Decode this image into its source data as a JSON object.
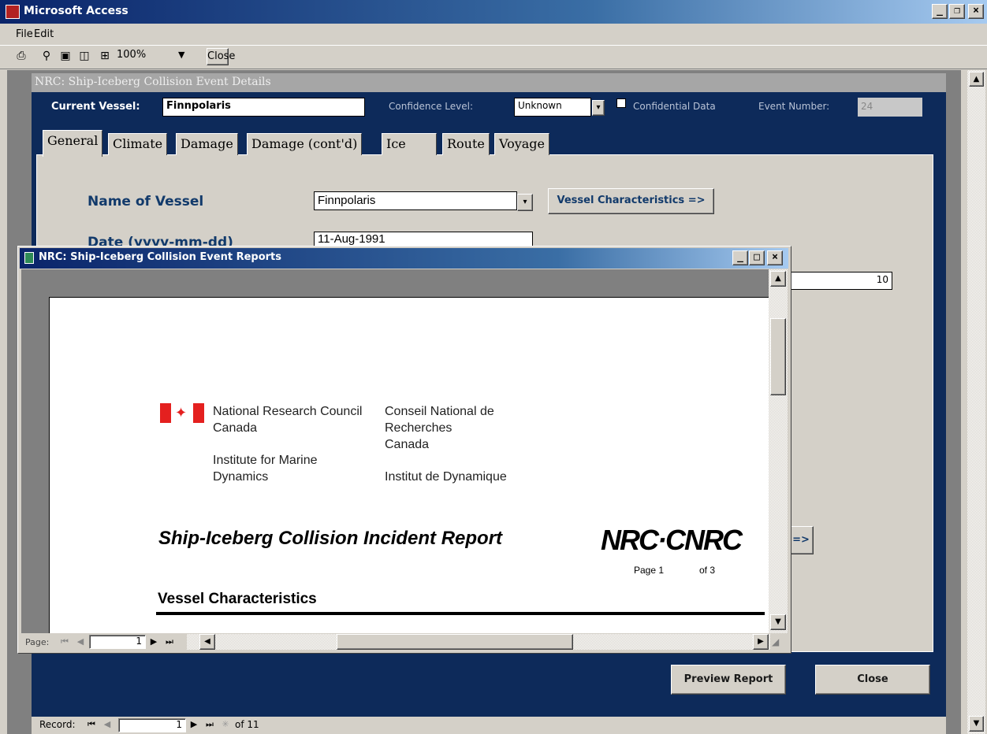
{
  "app": {
    "title": "Microsoft Access",
    "controls": [
      "_",
      "❐",
      "×"
    ]
  },
  "menu": {
    "file": "File",
    "edit": "Edit"
  },
  "toolbar": {
    "zoom": "100%",
    "close": "Close"
  },
  "form": {
    "title": "NRC: Ship-Iceberg Collision Event Details",
    "current_vessel_label": "Current Vessel:",
    "current_vessel_value": "Finnpolaris",
    "confidence_label": "Confidence Level:",
    "confidence_value": "Unknown",
    "confidential_label": "Confidential Data",
    "event_number_label": "Event Number:",
    "event_number_value": "24",
    "tabs": [
      "General",
      "Climate",
      "Damage",
      "Damage (cont'd)",
      "Ice",
      "Route",
      "Voyage"
    ],
    "name_of_vessel_label": "Name of Vessel",
    "name_of_vessel_value": "Finnpolaris",
    "vessel_characteristics_button": "Vessel Characteristics =>",
    "date_label": "Date (yyyy-mm-dd)",
    "date_value": "11-Aug-1991",
    "partial_field_value": "10",
    "partial_button": "=>",
    "preview_button": "Preview Report",
    "close_button": "Close",
    "record_label": "Record:",
    "record_current": "1",
    "record_total": "of 11"
  },
  "report": {
    "window_title": "NRC: Ship-Iceberg Collision Event Reports",
    "org_en_1": "National Research Council",
    "org_en_2": "Canada",
    "org_fr_1": "Conseil National de",
    "org_fr_2": "Recherches",
    "org_fr_3": "Canada",
    "inst_en_1": "Institute for Marine",
    "inst_en_2": "Dynamics",
    "inst_fr": "Institut de Dynamique",
    "heading": "Ship-Iceberg Collision Incident Report",
    "logo": "NRC·CNRC",
    "page_label": "Page 1",
    "page_of": "of 3",
    "section": "Vessel Characteristics",
    "page_nav_label": "Page:",
    "page_nav_value": "1"
  },
  "colors": {
    "form_bg": "#0d2a5a",
    "accent": "#123a6b",
    "flag_red": "#e4201f"
  }
}
